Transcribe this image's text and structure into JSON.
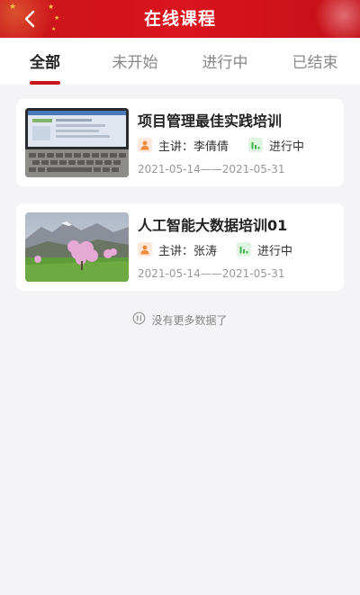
{
  "header": {
    "title": "在线课程",
    "back_icon": "chevron-left-icon"
  },
  "tabs": [
    {
      "label": "全部",
      "active": true
    },
    {
      "label": "未开始",
      "active": false
    },
    {
      "label": "进行中",
      "active": false
    },
    {
      "label": "已结束",
      "active": false
    }
  ],
  "courses": [
    {
      "title": "项目管理最佳实践培训",
      "lecturer_prefix": "主讲：",
      "lecturer": "李倩倩",
      "status": "进行中",
      "dates": "2021-05-14——2021-05-31",
      "thumbnail": "laptop-keyboard-image"
    },
    {
      "title": "人工智能大数据培训01",
      "lecturer_prefix": "主讲：",
      "lecturer": "张涛",
      "status": "进行中",
      "dates": "2021-05-14——2021-05-31",
      "thumbnail": "blossom-landscape-image"
    }
  ],
  "footer": {
    "no_more": "没有更多数据了",
    "icon": "pause-circle-icon"
  },
  "colors": {
    "brand_red": "#c8151b",
    "lecturer_icon": "#f08a3c",
    "status_icon": "#3bb54a"
  }
}
